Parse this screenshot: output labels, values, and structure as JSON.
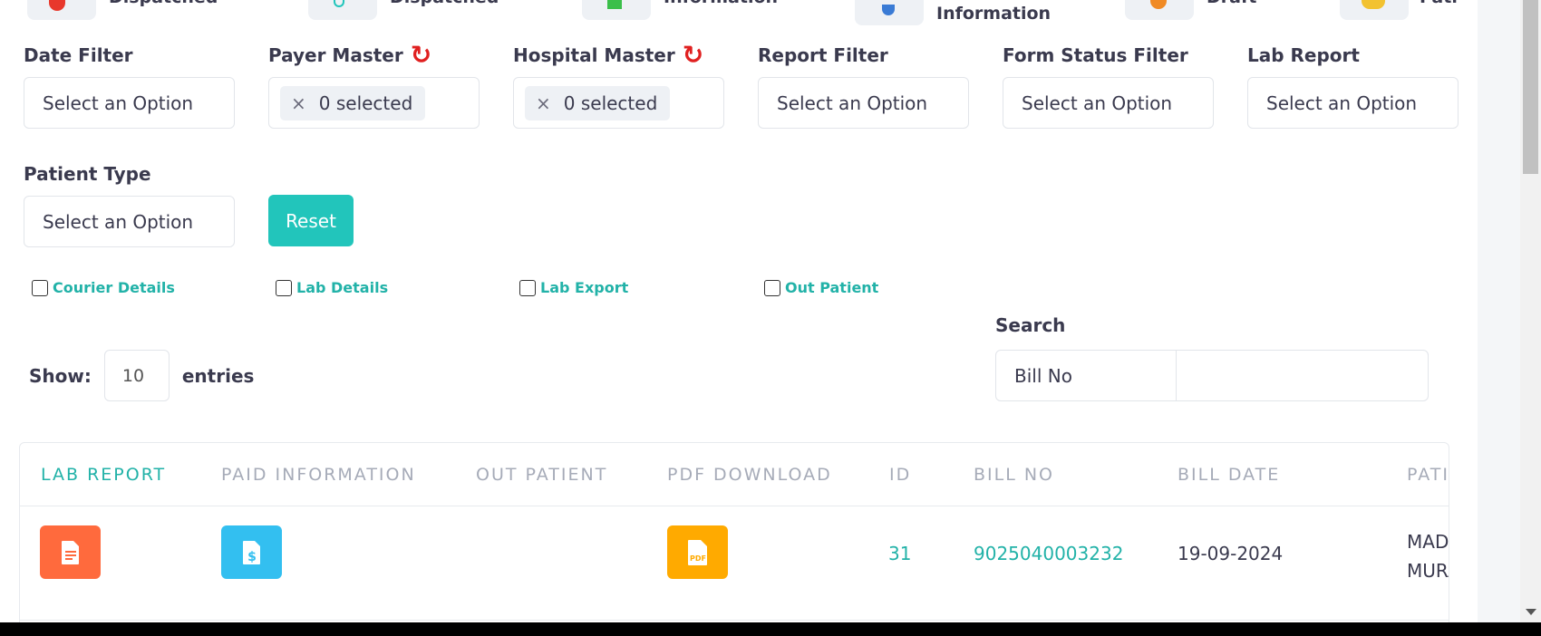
{
  "top_tiles": [
    {
      "label": "Dispatched",
      "icon": "red-circle-icon",
      "color": "#e8382c"
    },
    {
      "label": "Dispatched",
      "icon": "teal-hand-icon",
      "color": "#22c5bb"
    },
    {
      "label": "Information",
      "icon": "green-doc-icon",
      "color": "#3bbf4a"
    },
    {
      "label": "Information",
      "icon": "blue-pin-icon",
      "color": "#3a7bd5"
    },
    {
      "label": "Draft",
      "icon": "orange-draft-icon",
      "color": "#f08a24"
    },
    {
      "label": "Pati",
      "icon": "yellow-people-icon",
      "color": "#f2c230"
    }
  ],
  "filters": {
    "date_filter": {
      "label": "Date Filter",
      "value": "Select an Option"
    },
    "payer_master": {
      "label": "Payer Master",
      "chip": "0 selected"
    },
    "hospital_master": {
      "label": "Hospital Master",
      "chip": "0 selected"
    },
    "report_filter": {
      "label": "Report Filter",
      "value": "Select an Option"
    },
    "form_status_filter": {
      "label": "Form Status Filter",
      "value": "Select an Option"
    },
    "lab_report": {
      "label": "Lab Report",
      "value": "Select an Option"
    },
    "patient_type": {
      "label": "Patient Type",
      "value": "Select an Option"
    },
    "reset_label": "Reset"
  },
  "checkboxes": [
    {
      "label": "Courier Details",
      "checked": false
    },
    {
      "label": "Lab Details",
      "checked": false
    },
    {
      "label": "Lab Export",
      "checked": false
    },
    {
      "label": "Out Patient",
      "checked": false
    }
  ],
  "length": {
    "show_label": "Show:",
    "value": "10",
    "entries_label": "entries"
  },
  "search": {
    "label": "Search",
    "field": "Bill No",
    "value": ""
  },
  "table": {
    "columns": [
      "LAB REPORT",
      "PAID INFORMATION",
      "OUT PATIENT",
      "PDF DOWNLOAD",
      "ID",
      "BILL NO",
      "BILL DATE",
      "PATI"
    ],
    "rows": [
      {
        "lab_report_icon": "report-icon",
        "paid_info_icon": "dollar-doc-icon",
        "pdf_icon": "pdf-icon",
        "id": "31",
        "bill_no": "9025040003232",
        "bill_date": "19-09-2024",
        "patient_line1": "MADH",
        "patient_line2": "MURA"
      }
    ]
  },
  "colors": {
    "accent": "#22c5bb",
    "lab_report_btn": "#ff6a3d",
    "paid_info_btn": "#33bff0",
    "pdf_btn": "#ffaa00",
    "refresh": "#e02020"
  }
}
